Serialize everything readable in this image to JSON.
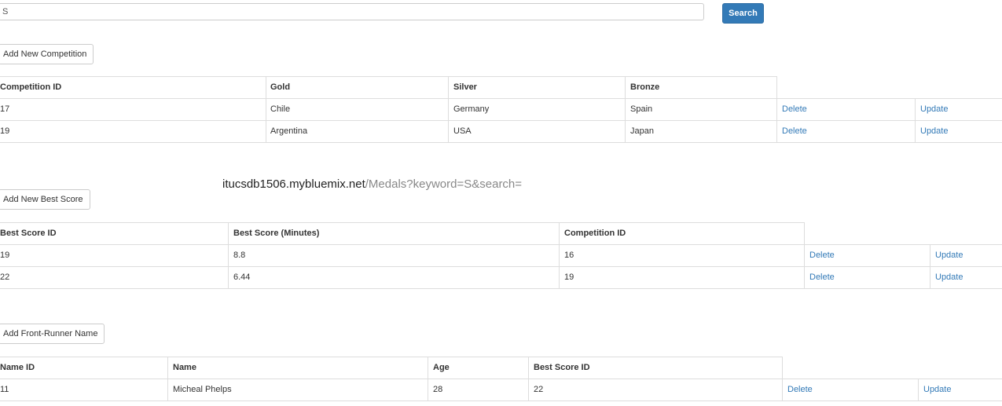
{
  "search": {
    "value": "S",
    "button_label": "Search"
  },
  "url": {
    "host": "itucsdb1506.mybluemix.net",
    "path": "/Medals?keyword=S&search="
  },
  "competitions": {
    "add_label": "Add New Competition",
    "headers": [
      "Competition ID",
      "Gold",
      "Silver",
      "Bronze"
    ],
    "rows": [
      {
        "id": "17",
        "gold": "Chile",
        "silver": "Germany",
        "bronze": "Spain",
        "delete": "Delete",
        "update": "Update"
      },
      {
        "id": "19",
        "gold": "Argentina",
        "silver": "USA",
        "bronze": "Japan",
        "delete": "Delete",
        "update": "Update"
      }
    ]
  },
  "best_scores": {
    "add_label": "Add New Best Score",
    "headers": [
      "Best Score ID",
      "Best Score (Minutes)",
      "Competition ID"
    ],
    "rows": [
      {
        "id": "19",
        "score": "8.8",
        "competition_id": "16",
        "delete": "Delete",
        "update": "Update"
      },
      {
        "id": "22",
        "score": "6.44",
        "competition_id": "19",
        "delete": "Delete",
        "update": "Update"
      }
    ]
  },
  "front_runners": {
    "add_label": "Add Front-Runner Name",
    "headers": [
      "Name ID",
      "Name",
      "Age",
      "Best Score ID"
    ],
    "rows": [
      {
        "id": "11",
        "name": "Micheal Phelps",
        "age": "28",
        "best_score_id": "22",
        "delete": "Delete",
        "update": "Update"
      }
    ]
  },
  "colors": {
    "primary": "#337ab7",
    "link": "#337ab7",
    "border": "#dddddd"
  }
}
